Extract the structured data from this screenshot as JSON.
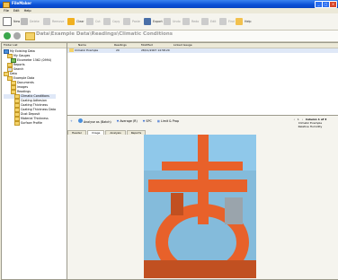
{
  "window": {
    "title": "FileMaker"
  },
  "menu": [
    "File",
    "Edit",
    "Help"
  ],
  "toolbar": {
    "items": [
      {
        "label": "New",
        "icon": "new-icon",
        "enabled": true
      },
      {
        "label": "Delete",
        "icon": "delete-icon",
        "enabled": false
      },
      {
        "label": "Remove",
        "icon": "remove-icon",
        "enabled": false
      },
      {
        "label": "Clear",
        "icon": "clear-icon",
        "enabled": true
      },
      {
        "label": "Cut",
        "icon": "cut-icon",
        "enabled": false
      },
      {
        "label": "Copy",
        "icon": "copy-icon",
        "enabled": false
      },
      {
        "label": "Paste",
        "icon": "paste-icon",
        "enabled": false
      },
      {
        "label": "Export",
        "icon": "export-icon",
        "enabled": true
      },
      {
        "label": "Undo",
        "icon": "undo-icon",
        "enabled": false
      },
      {
        "label": "Redo",
        "icon": "redo-icon",
        "enabled": false
      },
      {
        "label": "Edit",
        "icon": "edit-icon",
        "enabled": false
      },
      {
        "label": "Find",
        "icon": "find-icon",
        "enabled": false
      },
      {
        "label": "Help",
        "icon": "help-icon",
        "enabled": true
      }
    ]
  },
  "path": {
    "text": "Data\\Example Data\\Readings\\Climatic Conditions"
  },
  "tree": {
    "header": "Folder List",
    "items": [
      {
        "label": "My Existing Data",
        "level": 0
      },
      {
        "label": "My Gauges",
        "level": 1
      },
      {
        "label": "Elcometer 1562 (0994)",
        "level": 2
      },
      {
        "label": "Reports",
        "level": 1
      },
      {
        "label": "Search",
        "level": 1
      },
      {
        "label": "Data",
        "level": 0
      },
      {
        "label": "Example Data",
        "level": 1
      },
      {
        "label": "Documents",
        "level": 2
      },
      {
        "label": "Images",
        "level": 2
      },
      {
        "label": "Readings",
        "level": 2
      },
      {
        "label": "Climatic Conditions",
        "level": 3,
        "selected": true
      },
      {
        "label": "Coating Adhesion",
        "level": 3
      },
      {
        "label": "Coating Thickness",
        "level": 3
      },
      {
        "label": "Coating Thickness Data",
        "level": 3
      },
      {
        "label": "Dust Deposit",
        "level": 3
      },
      {
        "label": "Material Thickness",
        "level": 3
      },
      {
        "label": "Surface Profile",
        "level": 3
      }
    ]
  },
  "grid": {
    "columns": [
      "Name",
      "Readings",
      "Modified",
      "Linked Gauge"
    ],
    "rows": [
      {
        "name": "Climatic Example",
        "readings": "20",
        "modified": "28/11/2007 14:58:20",
        "gauge": ""
      }
    ]
  },
  "bottom_toolbar": {
    "analyse_label": "Analyse as (Batch)",
    "average_label": "Average (R)",
    "spc_label": "SPC",
    "limits_label": "Limit & Prop"
  },
  "tabs": [
    "Header",
    "Image",
    "Analysis",
    "Reports"
  ],
  "selected_tab": "Image",
  "info": {
    "nav": "1",
    "column_label": "Column 1 of 3",
    "line1": "Climatic Example",
    "line2": "Relative Humidity"
  },
  "colors": {
    "titlebar": "#0a4fd6",
    "pipe": "#e8612a",
    "sky": "#4da8de"
  }
}
